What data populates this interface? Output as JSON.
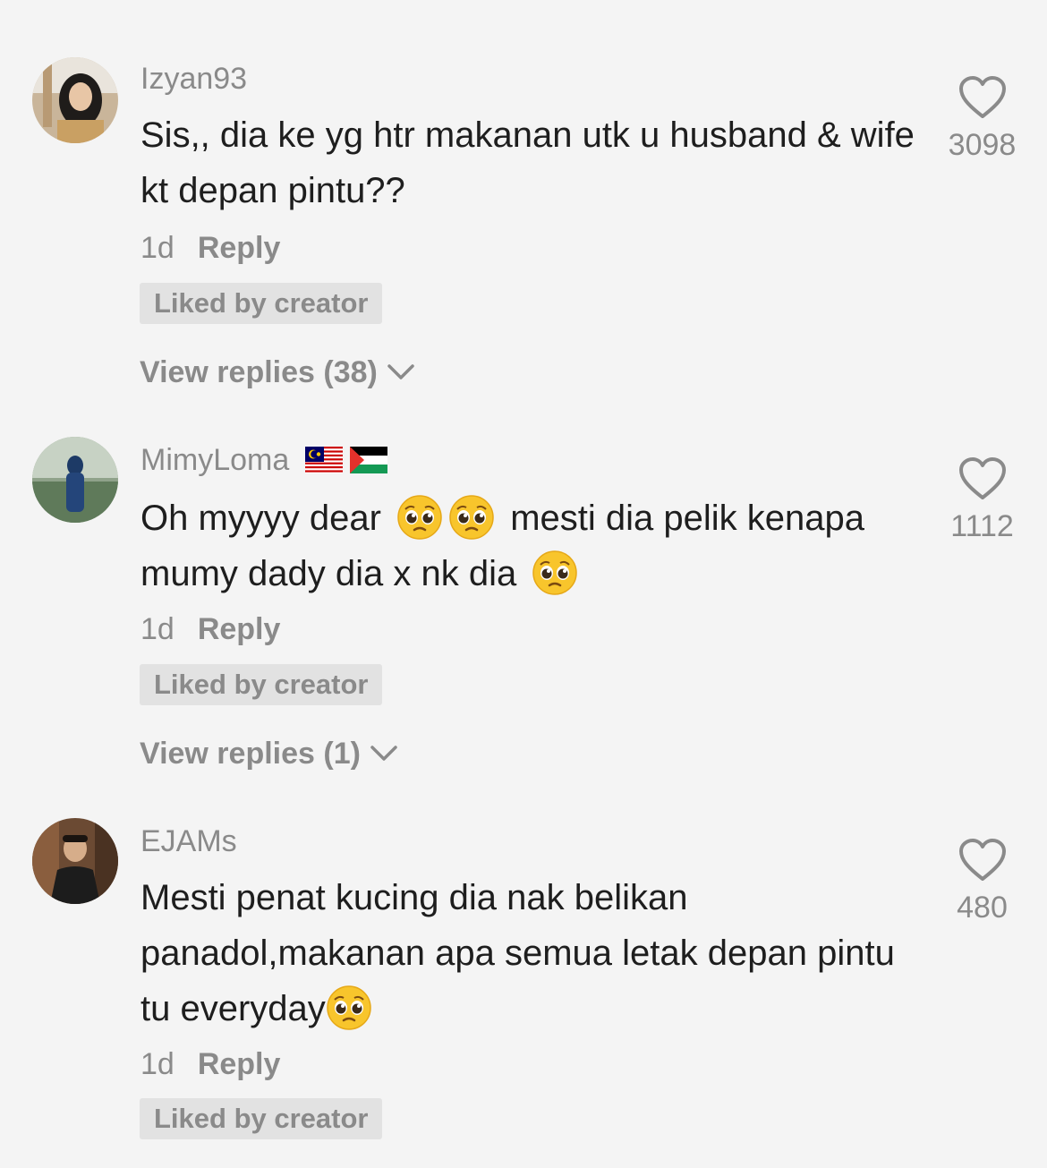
{
  "comments": [
    {
      "username": "Izyan93",
      "text": "Sis,, dia ke yg htr makanan utk u husband & wife kt depan pintu??",
      "time": "1d",
      "reply_label": "Reply",
      "liked_badge": "Liked by creator",
      "view_replies": "View replies (38)",
      "like_count": "3098"
    },
    {
      "username": "MimyLoma",
      "flags": [
        "malaysia-flag",
        "palestine-flag"
      ],
      "text_part1": "Oh myyyy dear",
      "text_part2": "mesti dia pelik kenapa mumy dady dia x nk dia",
      "time": "1d",
      "reply_label": "Reply",
      "liked_badge": "Liked by creator",
      "view_replies": "View replies (1)",
      "like_count": "1112"
    },
    {
      "username": "EJAMs",
      "text": "Mesti penat kucing dia nak belikan panadol,makanan apa semua letak depan pintu tu everyday",
      "time": "1d",
      "reply_label": "Reply",
      "liked_badge": "Liked by creator",
      "like_count": "480"
    }
  ],
  "icons": {
    "heart": "heart-outline-icon",
    "chevron": "chevron-down-icon",
    "emoji": "pleading-face-emoji"
  },
  "colors": {
    "background": "#f4f4f4",
    "secondary_text": "#8a8a8a",
    "primary_text": "#1e1e1e",
    "badge_bg": "#e2e2e2"
  }
}
